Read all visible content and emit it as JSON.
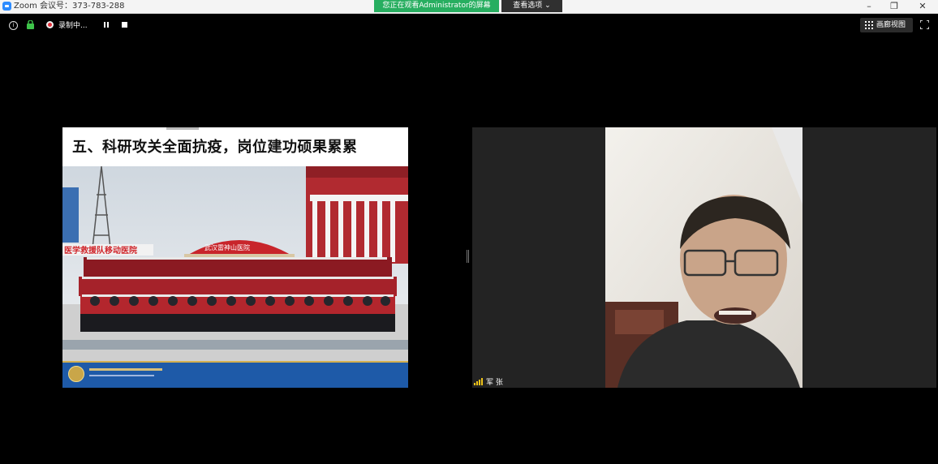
{
  "window": {
    "title": "Zoom 会议号：373-783-288",
    "share_banner": "您正在观看Administrator的屏幕",
    "view_options": "查看选项 ⌄",
    "controls": {
      "minimize": "–",
      "restore": "❐",
      "close": "✕"
    }
  },
  "toolbar": {
    "recording_label": "录制中...",
    "gallery_view_label": "画廊视图"
  },
  "shared_slide": {
    "title": "五、科研攻关全面抗疫，岗位建功硕果累累"
  },
  "participant": {
    "name": "军 张"
  },
  "icons": [
    "info-icon",
    "lock-icon",
    "record-icon",
    "pause-icon",
    "stop-icon",
    "grid-icon",
    "fullscreen-icon",
    "signal-icon"
  ],
  "colors": {
    "share_banner": "#27ae60",
    "record": "#e0303a",
    "lock": "#3ec44a",
    "signal": "#f0c419"
  }
}
